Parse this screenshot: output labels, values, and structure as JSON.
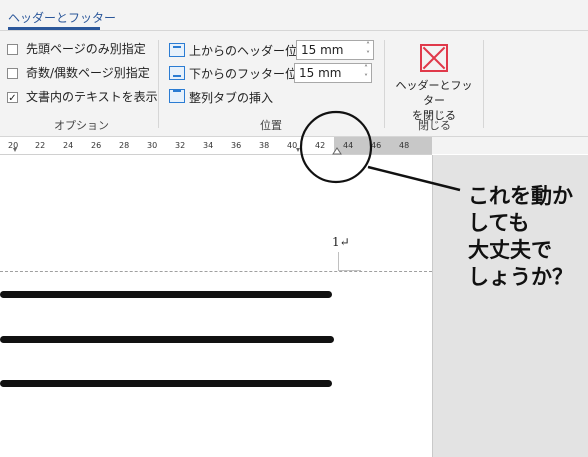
{
  "tab": {
    "label": "ヘッダーとフッター"
  },
  "options": {
    "items": [
      {
        "label": "先頭ページのみ別指定",
        "checked": false
      },
      {
        "label": "奇数/偶数ページ別指定",
        "checked": false
      },
      {
        "label": "文書内のテキストを表示",
        "checked": true
      }
    ],
    "group_label": "オプション"
  },
  "position": {
    "header_label": "上からのヘッダー位置:",
    "header_value": "15 mm",
    "footer_label": "下からのフッター位置:",
    "footer_value": "15 mm",
    "align_tab_label": "整列タブの挿入",
    "group_label": "位置"
  },
  "close": {
    "button_label_line1": "ヘッダーとフッター",
    "button_label_line2": "を閉じる",
    "group_label": "閉じる"
  },
  "ruler": {
    "ticks": [
      "20",
      "22",
      "24",
      "26",
      "28",
      "30",
      "32",
      "34",
      "36",
      "38",
      "40",
      "42",
      "44",
      "46",
      "48"
    ]
  },
  "document": {
    "page_number": "1↵"
  },
  "annotation": {
    "text": "これを動か\nしても\n大丈夫で\nしょうか？"
  }
}
